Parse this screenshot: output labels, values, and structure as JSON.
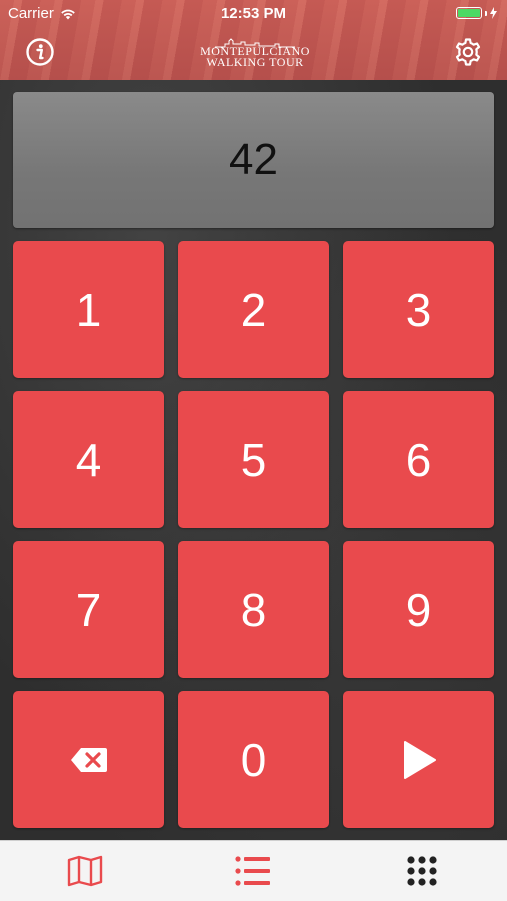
{
  "status_bar": {
    "carrier": "Carrier",
    "time": "12:53 PM"
  },
  "header": {
    "logo_line1": "MONTEPULCIANO",
    "logo_line2": "WALKING TOUR"
  },
  "display": {
    "value": "42"
  },
  "keypad": {
    "keys": [
      "1",
      "2",
      "3",
      "4",
      "5",
      "6",
      "7",
      "8",
      "9",
      "0"
    ]
  },
  "icons": {
    "info": "info-icon",
    "settings": "gear-icon",
    "delete": "backspace-icon",
    "play": "play-icon",
    "map": "map-icon",
    "list": "list-icon",
    "grid": "grid-icon"
  },
  "colors": {
    "accent": "#e94a4d",
    "tab_active": "#e94a4d",
    "tab_inactive": "#222222"
  }
}
